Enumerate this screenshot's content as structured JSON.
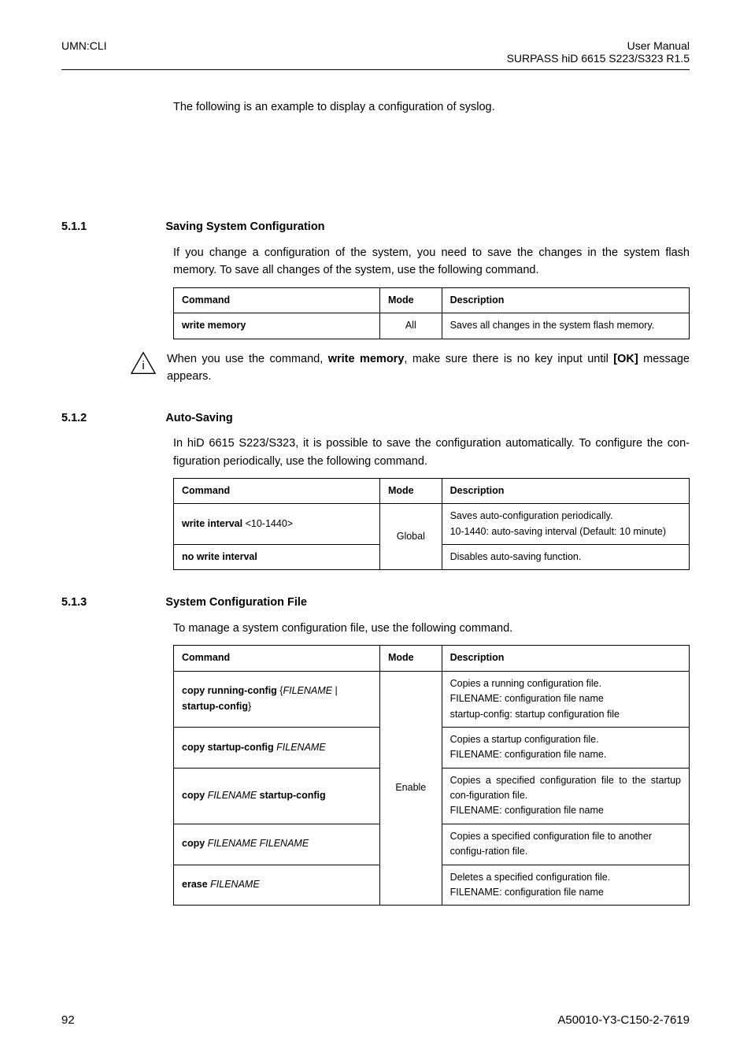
{
  "header": {
    "left": "UMN:CLI",
    "right_line1": "User Manual",
    "right_line2": "SURPASS hiD 6615 S223/S323 R1.5"
  },
  "intro_example": "The following is an example to display a configuration of syslog.",
  "sec_save": {
    "num": "5.1.1",
    "title": "Saving System Configuration",
    "para": "If you change a configuration of the system, you need to save the changes in the system flash memory. To save all changes of the system, use the following command.",
    "table": {
      "h1": "Command",
      "h2": "Mode",
      "h3": "Description",
      "r1c1": "write memory",
      "r1c2": "All",
      "r1c3": "Saves all changes in the system flash memory."
    },
    "note_a": "When you use the command, ",
    "note_cmd": "write memory",
    "note_b": ", make sure there is no key input until ",
    "note_c": "[OK]",
    "note_d": " message appears."
  },
  "sec_auto": {
    "num": "5.1.2",
    "title": "Auto-Saving",
    "para": "In hiD 6615 S223/S323, it is possible to save the configuration automatically. To configure the con-figuration periodically, use the following command.",
    "table": {
      "h1": "Command",
      "h2": "Mode",
      "h3": "Description",
      "r1c1a": "write interval ",
      "r1c1b": "<10-1440>",
      "r1c3a": "Saves auto-configuration periodically.",
      "r1c3b": "10-1440: auto-saving interval (Default: 10 minute)",
      "r2c1": "no write interval",
      "r2c3": "Disables auto-saving function.",
      "mode": "Global"
    }
  },
  "sec_file": {
    "num": "5.1.3",
    "title": "System Configuration File",
    "para": "To manage a system configuration file, use the following command.",
    "table": {
      "h1": "Command",
      "h2": "Mode",
      "h3": "Description",
      "mode": "Enable",
      "r1c1a": "copy running-config ",
      "r1c1b": "{",
      "r1c1c": "FILENAME",
      "r1c1d": " | ",
      "r1c1e": "startup-config",
      "r1c1f": "}",
      "r1c3a": "Copies a running configuration file.",
      "r1c3b": "FILENAME: configuration file name",
      "r1c3c": "startup-config: startup configuration file",
      "r2c1a": "copy startup-config ",
      "r2c1b": "FILENAME",
      "r2c3a": "Copies a startup configuration file.",
      "r2c3b": "FILENAME: configuration file name.",
      "r3c1a": "copy ",
      "r3c1b": "FILENAME",
      "r3c1c": " startup-config",
      "r3c3a": "Copies a specified configuration file to the startup con-figuration file.",
      "r3c3b": "FILENAME: configuration file name",
      "r4c1a": "copy ",
      "r4c1b": "FILENAME FILENAME",
      "r4c3": "Copies a specified configuration file to another configu-ration file.",
      "r5c1a": "erase ",
      "r5c1b": "FILENAME",
      "r5c3a": "Deletes a specified configuration file.",
      "r5c3b": "FILENAME: configuration file name"
    }
  },
  "footer": {
    "page": "92",
    "doc": "A50010-Y3-C150-2-7619"
  }
}
